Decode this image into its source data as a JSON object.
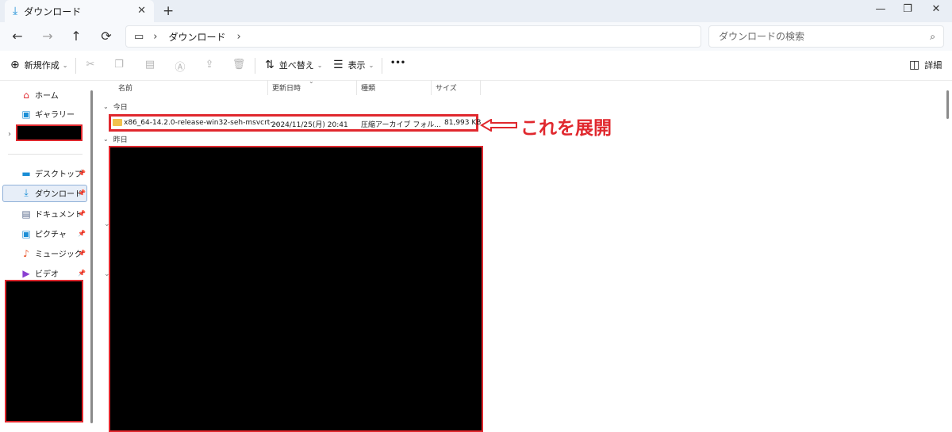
{
  "window": {
    "tab_title": "ダウンロード",
    "tab_icon": "download-icon",
    "close_glyph": "✕",
    "newtab_glyph": "+",
    "minimize_glyph": "—",
    "maximize_glyph": "❐",
    "window_close_glyph": "✕"
  },
  "nav": {
    "back": "←",
    "forward": "→",
    "up": "↑",
    "refresh": "⟳",
    "breadcrumb": [
      "ダウンロード"
    ],
    "search_placeholder": "ダウンロードの検索"
  },
  "toolbar": {
    "new_label": "新規作成",
    "sort_label": "並べ替え",
    "view_label": "表示",
    "more_label": "•••",
    "details_label": "詳細",
    "icons": [
      "cut-icon",
      "copy-icon",
      "paste-icon",
      "rename-icon",
      "share-icon",
      "delete-icon"
    ]
  },
  "sidebar": {
    "items": [
      {
        "label": "ホーム",
        "icon": "home-icon",
        "pinned": false
      },
      {
        "label": "ギャラリー",
        "icon": "gallery-icon",
        "pinned": false
      },
      {
        "label": "デスクトップ",
        "icon": "desktop-icon",
        "pinned": true
      },
      {
        "label": "ダウンロード",
        "icon": "download-icon",
        "pinned": true,
        "active": true
      },
      {
        "label": "ドキュメント",
        "icon": "document-icon",
        "pinned": true
      },
      {
        "label": "ピクチャ",
        "icon": "pictures-icon",
        "pinned": true
      },
      {
        "label": "ミュージック",
        "icon": "music-icon",
        "pinned": true
      },
      {
        "label": "ビデオ",
        "icon": "video-icon",
        "pinned": true
      }
    ]
  },
  "columns": [
    "名前",
    "更新日時",
    "種類",
    "サイズ"
  ],
  "groups": {
    "today": "今日",
    "yesterday": "昨日"
  },
  "file": {
    "name": "x86_64-14.2.0-release-win32-seh-msvcrt-...",
    "modified": "2024/11/25(月) 20:41",
    "type": "圧縮アーカイブ フォル...",
    "size": "81,993 KB"
  },
  "annotation": {
    "text": "これを展開",
    "color": "#e0282e"
  },
  "colors": {
    "accent": "#1b8ed6",
    "highlight": "#e0282e",
    "folder": "#f2c14e"
  }
}
